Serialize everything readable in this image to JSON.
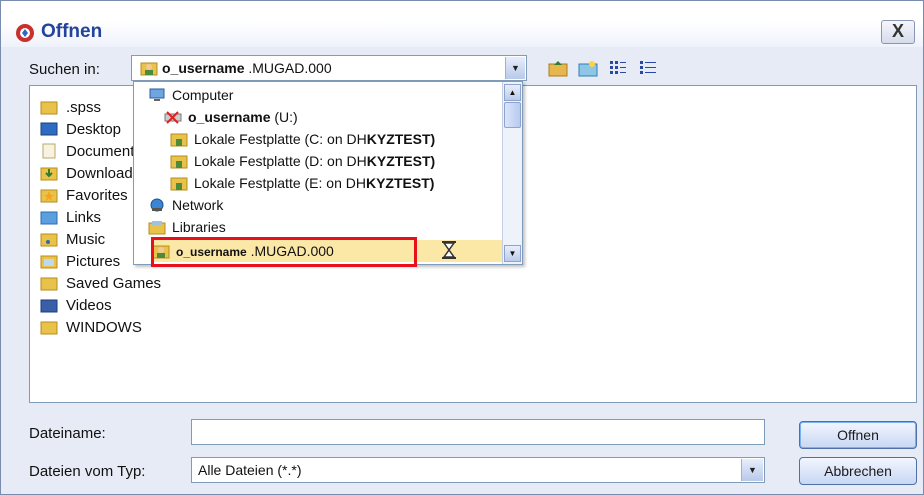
{
  "window": {
    "title": "Offnen",
    "close_label": "X"
  },
  "lookin": {
    "label": "Suchen in:",
    "selected_user": "o_username",
    "selected_suffix": ".MUGAD.000"
  },
  "files": [
    {
      "name": ".spss",
      "icon": "folder-icon"
    },
    {
      "name": "Desktop",
      "icon": "desktop-icon"
    },
    {
      "name": "Documents",
      "icon": "documents-icon"
    },
    {
      "name": "Downloads",
      "icon": "downloads-icon"
    },
    {
      "name": "Favorites",
      "icon": "favorites-icon"
    },
    {
      "name": "Links",
      "icon": "links-icon"
    },
    {
      "name": "Music",
      "icon": "music-icon"
    },
    {
      "name": "Pictures",
      "icon": "pictures-icon"
    },
    {
      "name": "Saved Games",
      "icon": "folder-icon"
    },
    {
      "name": "Videos",
      "icon": "videos-icon"
    },
    {
      "name": "WINDOWS",
      "icon": "folder-icon"
    }
  ],
  "dropdown": {
    "items": [
      {
        "label": "Computer",
        "icon": "computer-icon"
      },
      {
        "label": "o_username",
        "suffix": "(U:)",
        "icon": "network-drive-icon"
      },
      {
        "label": "Lokale Festplatte (C: on DH",
        "suffix": "KYZTEST)",
        "icon": "user-folder-icon"
      },
      {
        "label": "Lokale Festplatte (D: on DH",
        "suffix": "KYZTEST)",
        "icon": "user-folder-icon"
      },
      {
        "label": "Lokale Festplatte (E: on DH",
        "suffix": "KYZTEST)",
        "icon": "user-folder-icon"
      },
      {
        "label": "Network",
        "icon": "network-icon"
      },
      {
        "label": "Libraries",
        "icon": "libraries-icon"
      },
      {
        "label": "o_username",
        "suffix": ".MUGAD.000",
        "icon": "user-folder-icon"
      }
    ]
  },
  "filename": {
    "label": "Dateiname:",
    "value": ""
  },
  "filetype": {
    "label": "Dateien vom Typ:",
    "value": "Alle Dateien (*.*)"
  },
  "buttons": {
    "open": "Offnen",
    "cancel": "Abbrechen"
  },
  "colors": {
    "accent": "#23439c",
    "highlight": "#e8101c",
    "selection": "#fbe8a6"
  }
}
